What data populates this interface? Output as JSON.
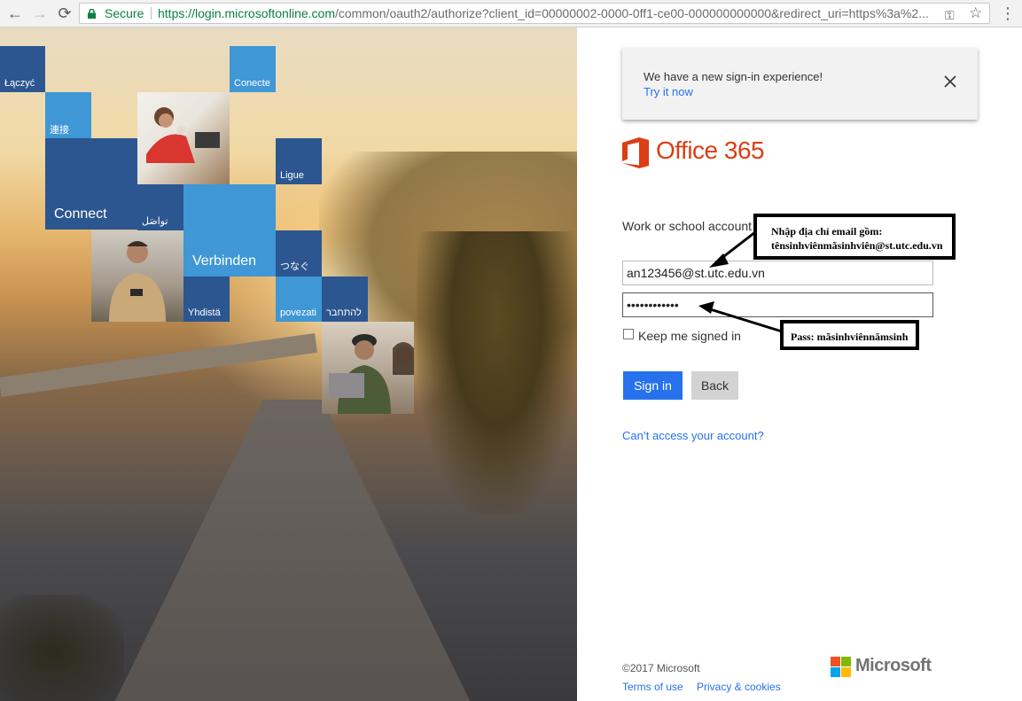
{
  "browser": {
    "secure_label": "Secure",
    "url_host": "https://login.microsoftonline.com",
    "url_rest": "/common/oauth2/authorize?client_id=00000002-0000-0ff1-ce00-000000000000&redirect_uri=https%3a%2...",
    "back_glyph": "←",
    "forward_glyph": "→",
    "reload_glyph": "⟳",
    "key_glyph": "⚿",
    "star_glyph": "☆",
    "menu_glyph": "⋮"
  },
  "tiles": [
    {
      "text": "Łączyć"
    },
    {
      "text": "Conecte"
    },
    {
      "text": "連接"
    },
    {
      "text": "Ligue"
    },
    {
      "text": "Connect"
    },
    {
      "text": "تواصَل"
    },
    {
      "text": "Verbinden"
    },
    {
      "text": "つなぐ"
    },
    {
      "text": "Yhdistä"
    },
    {
      "text": "povezati"
    },
    {
      "text": "להתחבר"
    }
  ],
  "banner": {
    "message": "We have a new sign-in experience!",
    "link": "Try it now"
  },
  "brand": {
    "product": "Office 365",
    "color": "#dc3e15"
  },
  "form": {
    "account_label": "Work or school account",
    "email_value": "an123456@st.utc.edu.vn",
    "password_value": "••••••••••••",
    "keep_signed_in": "Keep me signed in",
    "keep_signed_in_checked": false,
    "signin_label": "Sign in",
    "back_label": "Back",
    "cant_access": "Can’t access your account?"
  },
  "footer": {
    "copyright": "©2017 Microsoft",
    "terms": "Terms of use",
    "privacy": "Privacy & cookies",
    "ms_brand": "Microsoft"
  },
  "annotations": {
    "email_hint_line1": "Nhập địa chỉ email gồm:",
    "email_hint_line2": "tênsinhviênmãsinhviên@st.utc.edu.vn",
    "password_hint": "Pass: mãsinhviênnămsinh"
  },
  "colors": {
    "accent_blue": "#2672ec",
    "secure_green": "#0b8043",
    "tile_dark": "#2c5690",
    "tile_light": "#3f97d5"
  }
}
